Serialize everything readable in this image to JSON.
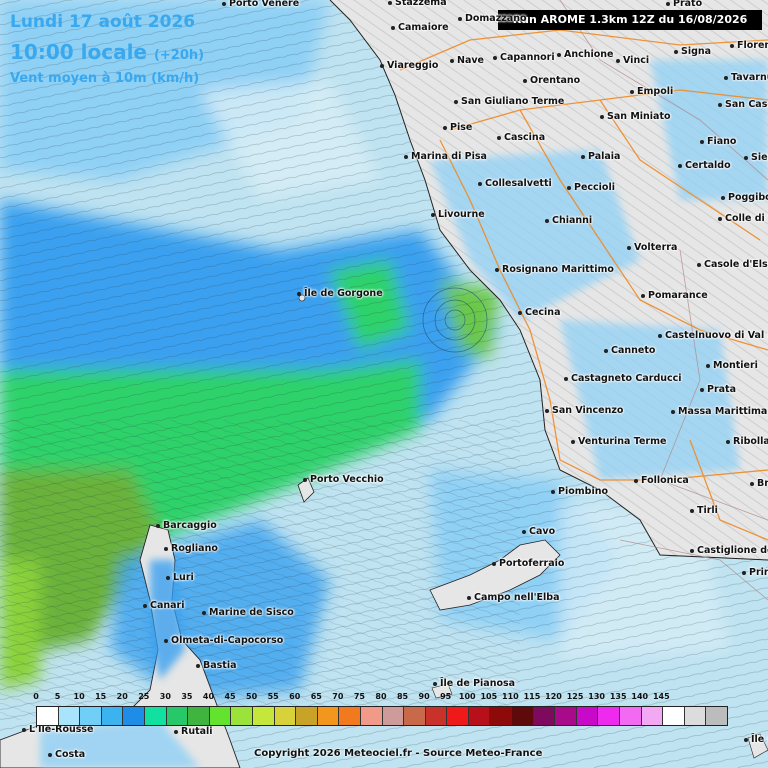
{
  "header": {
    "date": "Lundi 17 août 2026",
    "time": "10:00 locale",
    "offset": "(+20h)",
    "variable": "Vent moyen à 10m (km/h)"
  },
  "run_label": "Run AROME 1.3km 12Z du 16/08/2026",
  "copyright": "Copyright 2026 Meteociel.fr - Source Meteo-France",
  "colors": {
    "sea_base": "#bfe3f1",
    "wind_light": "#8fd0f5",
    "wind_mid": "#3aa0ef",
    "wind_strong": "#1e7fe8",
    "wind_green": "#2ed26b",
    "wind_olive": "#6bb23a",
    "land": "#e6e6e6",
    "road": "#f08a24",
    "header_text": "#39a8ee"
  },
  "legend": {
    "values": [
      "0",
      "5",
      "10",
      "15",
      "20",
      "25",
      "30",
      "35",
      "40",
      "45",
      "50",
      "55",
      "60",
      "65",
      "70",
      "75",
      "80",
      "85",
      "90",
      "95",
      "100",
      "105",
      "110",
      "115",
      "120",
      "125",
      "130",
      "135",
      "140",
      "145"
    ],
    "colors": [
      "#ffffff",
      "#a8e4fb",
      "#6fcff7",
      "#3bb3f0",
      "#1e8de8",
      "#11e0a0",
      "#27c86a",
      "#3fb540",
      "#63e22e",
      "#9be23a",
      "#c5e63a",
      "#d8d23a",
      "#c8a328",
      "#f2961e",
      "#f27a1e",
      "#f29a8a",
      "#cf9a9a",
      "#c86a4a",
      "#c8322a",
      "#ee1a1a",
      "#b8101a",
      "#8e0a0a",
      "#5e0a0a",
      "#7e0a5e",
      "#a80a8a",
      "#c80ac8",
      "#ee2aee",
      "#f26af2",
      "#f2a8f2",
      "#ffffff",
      "#dcdcdc",
      "#bcbcbc"
    ]
  },
  "cities": [
    {
      "name": "Porto Venere"
    },
    {
      "name": "Stazzema"
    },
    {
      "name": "Domazzano"
    },
    {
      "name": "Camaiore"
    },
    {
      "name": "Prato"
    },
    {
      "name": "Signa"
    },
    {
      "name": "Florence"
    },
    {
      "name": "Viareggio"
    },
    {
      "name": "Nave"
    },
    {
      "name": "Capannori"
    },
    {
      "name": "Anchione"
    },
    {
      "name": "Vinci"
    },
    {
      "name": "Tavarnuzze"
    },
    {
      "name": "Orentano"
    },
    {
      "name": "Empoli"
    },
    {
      "name": "San Giuliano Terme"
    },
    {
      "name": "San Casciano"
    },
    {
      "name": "San Miniato"
    },
    {
      "name": "Pise"
    },
    {
      "name": "Cascina"
    },
    {
      "name": "Fiano"
    },
    {
      "name": "Marina di Pisa"
    },
    {
      "name": "Palaia"
    },
    {
      "name": "Certaldo"
    },
    {
      "name": "Siena"
    },
    {
      "name": "Collesalvetti"
    },
    {
      "name": "Peccioli"
    },
    {
      "name": "Poggibonsi"
    },
    {
      "name": "Livourne"
    },
    {
      "name": "Chianni"
    },
    {
      "name": "Colle di Val d'Elsa"
    },
    {
      "name": "Volterra"
    },
    {
      "name": "Rosignano Marittimo"
    },
    {
      "name": "Casole d'Elsa"
    },
    {
      "name": "Île de Gorgone"
    },
    {
      "name": "Pomarance"
    },
    {
      "name": "Cecina"
    },
    {
      "name": "Castelnuovo di Val di Cecina"
    },
    {
      "name": "Canneto"
    },
    {
      "name": "Montieri"
    },
    {
      "name": "Castagneto Carducci"
    },
    {
      "name": "Prata"
    },
    {
      "name": "San Vincenzo"
    },
    {
      "name": "Massa Marittima"
    },
    {
      "name": "Ribolla"
    },
    {
      "name": "Venturina Terme"
    },
    {
      "name": "Porto Vecchio"
    },
    {
      "name": "Follonica"
    },
    {
      "name": "Piombino"
    },
    {
      "name": "Braccagni"
    },
    {
      "name": "Tirli"
    },
    {
      "name": "Barcaggio"
    },
    {
      "name": "Cavo"
    },
    {
      "name": "Castiglione della Pescaia"
    },
    {
      "name": "Rogliano"
    },
    {
      "name": "Portoferraio"
    },
    {
      "name": "Principina"
    },
    {
      "name": "Luri"
    },
    {
      "name": "Campo nell'Elba"
    },
    {
      "name": "Canari"
    },
    {
      "name": "Marine de Sisco"
    },
    {
      "name": "Olmeta-di-Capocorso"
    },
    {
      "name": "Bastia"
    },
    {
      "name": "Île de Pianosa"
    },
    {
      "name": "L'Île-Rousse"
    },
    {
      "name": "Rutali"
    },
    {
      "name": "Costa"
    },
    {
      "name": "Île du Giglio"
    }
  ]
}
